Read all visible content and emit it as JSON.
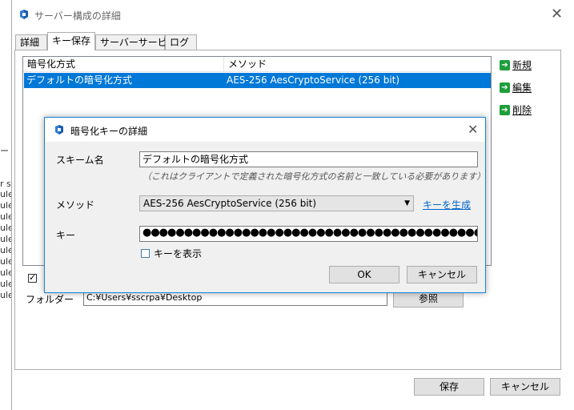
{
  "main": {
    "title": "サーバー構成の詳細",
    "tabs": [
      "詳細",
      "キー保存",
      "サーバーサービス",
      "ログ"
    ],
    "list": {
      "columns": [
        "暗号化方式",
        "メソッド"
      ],
      "rows": [
        {
          "scheme": "デフォルトの暗号化方式",
          "method": "AES-256 AesCryptoService (256 bit)"
        }
      ]
    },
    "side_buttons": [
      "新規",
      "編集",
      "削除"
    ],
    "folder_label": "フォルダー",
    "folder_value": "C:¥Users¥sscrpa¥Desktop",
    "browse_label": "参照",
    "save_label": "保存",
    "cancel_label": "キャンセル"
  },
  "background": {
    "fragments": [
      "ー",
      "r s",
      "ule",
      "ule",
      "ule",
      "ule",
      "ule",
      "ule",
      "ule",
      "ule",
      "ule",
      "ule"
    ]
  },
  "key_dialog": {
    "title": "暗号化キーの詳細",
    "scheme_name_label": "スキーム名",
    "scheme_name_value": "デフォルトの暗号化方式",
    "scheme_hint": "（これはクライアントで定義された暗号化方式の名前と一致している必要があります）",
    "method_label": "メソッド",
    "method_value": "AES-256 AesCryptoService (256 bit)",
    "generate_key_link": "キーを生成",
    "key_label": "キー",
    "key_value": "●●●●●●●●●●●●●●●●●●●●●●●●●●●●●●●●●●●●●●●●●●●●",
    "show_key_label": "キーを表示",
    "ok_label": "OK",
    "cancel_label": "キャンセル"
  },
  "colors": {
    "selection": "#0078d7",
    "accent_border": "#1883d7",
    "add_icon": "#1e9e3a"
  },
  "icons": [
    "app-icon",
    "close-icon",
    "green-arrow-icon",
    "checkbox-icon",
    "dropdown-caret-icon"
  ]
}
